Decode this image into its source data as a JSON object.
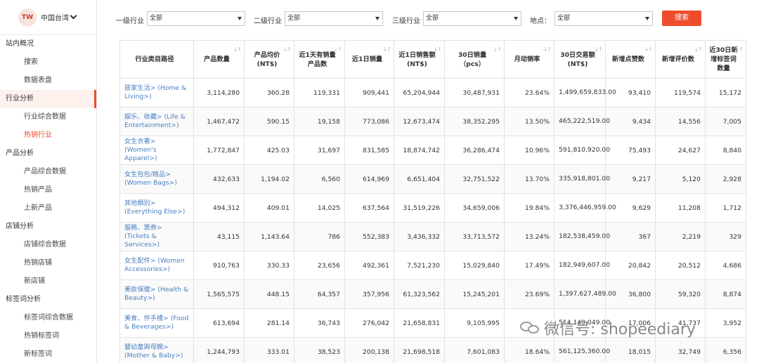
{
  "sidebar": {
    "avatar": "TW",
    "region": "中国台湾",
    "sections": [
      {
        "label": "站内概况",
        "items": [
          "搜索",
          "数据表盘"
        ]
      },
      {
        "label": "行业分析",
        "items": [
          "行业综合数据",
          "热销行业"
        ]
      },
      {
        "label": "产品分析",
        "items": [
          "产品综合数据",
          "热销产品",
          "上新产品"
        ]
      },
      {
        "label": "店铺分析",
        "items": [
          "店铺综合数据",
          "热销店铺",
          "新店铺"
        ]
      },
      {
        "label": "标签词分析",
        "items": [
          "标签词综合数据",
          "热销标签词",
          "新标签词"
        ]
      }
    ],
    "active_section": "行业分析",
    "active_item": "热销行业"
  },
  "filters": {
    "level1_label": "一级行业",
    "level1_value": "全部",
    "level2_label": "二级行业",
    "level2_value": "全部",
    "level3_label": "三级行业",
    "level3_value": "全部",
    "location_label": "地点：",
    "location_value": "全部",
    "search_label": "搜索"
  },
  "table": {
    "headers": [
      "行业类目路径",
      "产品数量",
      "产品均价(NT$)",
      "近1天有销量产品数",
      "近1日销量",
      "近1日销售额(NT$)",
      "30日销量（pcs）",
      "月动销率",
      "30日交易额(NT$)",
      "新增点赞数",
      "新增评价数",
      "近30日新增标签词数量"
    ],
    "rows": [
      [
        "居家生活> (Home & Living>)",
        "3,114,280",
        "360.28",
        "119,331",
        "909,441",
        "65,204,944",
        "30,487,931",
        "23.64%",
        "1,499,659,833.00",
        "93,410",
        "119,574",
        "15,172"
      ],
      [
        "娱乐、收藏> (Life & Entertainment>)",
        "1,467,472",
        "590.15",
        "19,158",
        "773,086",
        "12,673,474",
        "38,352,295",
        "13.50%",
        "465,222,519.00",
        "9,434",
        "14,556",
        "7,005"
      ],
      [
        "女生衣著> (Women's Apparel>)",
        "1,772,847",
        "425.03",
        "31,697",
        "831,585",
        "18,874,742",
        "36,286,474",
        "10.96%",
        "591,810,920.00",
        "75,493",
        "24,627",
        "8,840"
      ],
      [
        "女生包包/精品> (Women Bags>)",
        "432,633",
        "1,194.02",
        "6,560",
        "614,969",
        "6,651,404",
        "32,751,522",
        "13.70%",
        "335,918,801.00",
        "9,217",
        "5,120",
        "2,928"
      ],
      [
        "其他類別> (Everything Else>)",
        "494,312",
        "409.01",
        "14,025",
        "637,564",
        "31,519,226",
        "34,659,006",
        "19.84%",
        "3,376,446,959.00",
        "9,629",
        "11,208",
        "1,712"
      ],
      [
        "服務、票券> (Tickets & Services>)",
        "43,115",
        "1,143.64",
        "786",
        "552,383",
        "3,436,332",
        "33,713,572",
        "13.24%",
        "182,538,459.00",
        "367",
        "2,219",
        "329"
      ],
      [
        "女生配件> (Women Accessories>)",
        "910,763",
        "330.33",
        "23,656",
        "492,361",
        "7,521,230",
        "15,029,840",
        "17.49%",
        "182,949,607.00",
        "20,842",
        "20,512",
        "4,686"
      ],
      [
        "美妝保健> (Health & Beauty>)",
        "1,565,575",
        "448.15",
        "64,357",
        "357,956",
        "61,323,562",
        "15,245,201",
        "23.69%",
        "1,397,627,489.00",
        "36,800",
        "59,320",
        "8,874"
      ],
      [
        "美食、伴手禮> (Food & Beverages>)",
        "613,694",
        "281.14",
        "36,743",
        "276,042",
        "21,658,831",
        "9,105,995",
        "",
        "514,149,049.00",
        "17,006",
        "41,737",
        "3,952"
      ],
      [
        "嬰幼童與母親> (Mother & Baby>)",
        "1,244,793",
        "333.01",
        "38,523",
        "200,138",
        "21,698,518",
        "7,601,083",
        "18.64%",
        "561,125,360.00",
        "18,015",
        "32,749",
        "6,356"
      ]
    ]
  },
  "watermark": "微信号: shopeediary",
  "colors": {
    "accent": "#ee4d2d",
    "link": "#4a7fc1"
  }
}
